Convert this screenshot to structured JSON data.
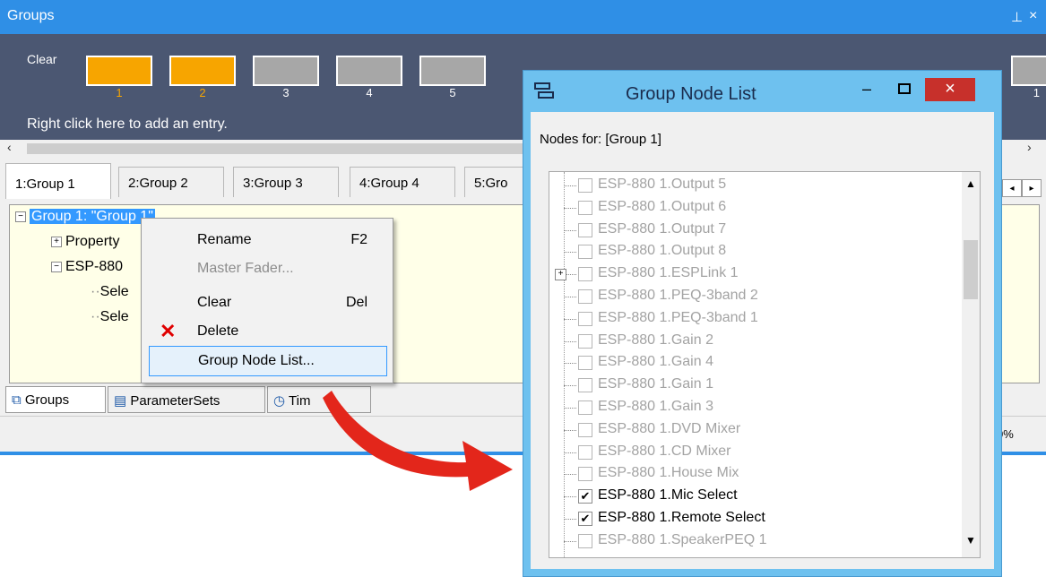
{
  "window": {
    "title": "Groups",
    "pin_icon": "pin-icon",
    "close_icon": "close-icon"
  },
  "group_panel": {
    "clear_label": "Clear",
    "slots": [
      {
        "num": "1",
        "active": true
      },
      {
        "num": "2",
        "active": true
      },
      {
        "num": "3",
        "active": false
      },
      {
        "num": "4",
        "active": false
      },
      {
        "num": "5",
        "active": false
      }
    ],
    "last_slot_num": "1",
    "hint": "Right click here to add an entry."
  },
  "tabs": [
    "1:Group 1",
    "2:Group 2",
    "3:Group 3",
    "4:Group 4",
    "5:Gro"
  ],
  "tree": {
    "root": "Group 1: \"Group 1\"",
    "items": [
      "Property",
      "ESP-880",
      "Sele",
      "Sele"
    ]
  },
  "context_menu": {
    "items": [
      {
        "label": "Rename",
        "shortcut": "F2",
        "enabled": true
      },
      {
        "label": "Master Fader...",
        "shortcut": "",
        "enabled": false
      },
      {
        "label": "Clear",
        "shortcut": "Del",
        "enabled": true
      },
      {
        "label": "Delete",
        "shortcut": "",
        "enabled": true,
        "icon": "delete-x-icon"
      },
      {
        "label": "Group Node List...",
        "shortcut": "",
        "enabled": true,
        "highlighted": true
      }
    ]
  },
  "bottom_tabs": [
    {
      "label": "Groups",
      "icon": "groups-icon"
    },
    {
      "label": "ParameterSets",
      "icon": "list-icon"
    },
    {
      "label": "Tim",
      "icon": "clock-icon"
    }
  ],
  "status": {
    "right_text": "0%"
  },
  "dialog": {
    "title": "Group Node List",
    "nodes_for": "Nodes for: [Group 1]",
    "minimize": "–",
    "close": "×",
    "nodes": [
      {
        "label": "ESP-880 1.Output 5",
        "checked": false,
        "enabled": false
      },
      {
        "label": "ESP-880 1.Output 6",
        "checked": false,
        "enabled": false
      },
      {
        "label": "ESP-880 1.Output 7",
        "checked": false,
        "enabled": false
      },
      {
        "label": "ESP-880 1.Output 8",
        "checked": false,
        "enabled": false
      },
      {
        "label": "ESP-880 1.ESPLink 1",
        "checked": false,
        "enabled": false,
        "expandable": true
      },
      {
        "label": "ESP-880 1.PEQ-3band 2",
        "checked": false,
        "enabled": false
      },
      {
        "label": "ESP-880 1.PEQ-3band 1",
        "checked": false,
        "enabled": false
      },
      {
        "label": "ESP-880 1.Gain 2",
        "checked": false,
        "enabled": false
      },
      {
        "label": "ESP-880 1.Gain 4",
        "checked": false,
        "enabled": false
      },
      {
        "label": "ESP-880 1.Gain 1",
        "checked": false,
        "enabled": false
      },
      {
        "label": "ESP-880 1.Gain 3",
        "checked": false,
        "enabled": false
      },
      {
        "label": "ESP-880 1.DVD Mixer",
        "checked": false,
        "enabled": false
      },
      {
        "label": "ESP-880 1.CD Mixer",
        "checked": false,
        "enabled": false
      },
      {
        "label": "ESP-880 1.House Mix",
        "checked": false,
        "enabled": false
      },
      {
        "label": "ESP-880 1.Mic Select",
        "checked": true,
        "enabled": true
      },
      {
        "label": "ESP-880 1.Remote Select",
        "checked": true,
        "enabled": true
      },
      {
        "label": "ESP-880 1.SpeakerPEQ 1",
        "checked": false,
        "enabled": false
      }
    ]
  },
  "colors": {
    "title_bar": "#2f8fe6",
    "panel": "#4b5772",
    "slot_active": "#f7a500",
    "dialog_frame": "#6ec1ef",
    "close_red": "#c7302b",
    "arrow": "#e3261b"
  }
}
